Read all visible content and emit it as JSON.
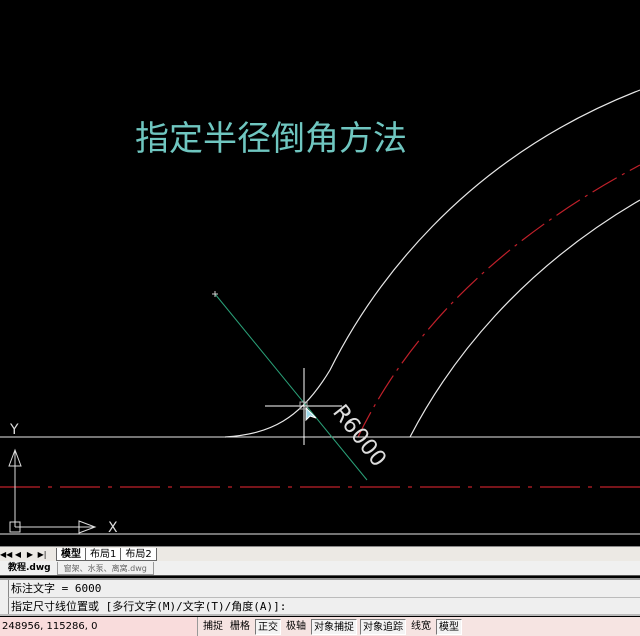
{
  "drawing": {
    "title": "指定半径倒角方法",
    "dim_text": "R6000",
    "ucs_x": "X",
    "ucs_y": "Y"
  },
  "colors": {
    "background": "#000000",
    "line": "#ffffff",
    "centerline": "#c0202a",
    "title": "#6fc6c0",
    "dimension": "#2aa078"
  },
  "layout_tabs": {
    "nav": [
      "◀◀",
      "◀",
      "▶",
      "▶|"
    ],
    "tabs": [
      {
        "label": "模型",
        "active": true
      },
      {
        "label": "布局1"
      },
      {
        "label": "布局2"
      }
    ]
  },
  "file_tabs": [
    {
      "label": "教程.dwg",
      "active": true
    },
    {
      "label": "窗架、水泵、离窝.dwg"
    }
  ],
  "command": {
    "lines": [
      "标注文字 = 6000",
      "指定尺寸线位置或 [多行文字(M)/文字(T)/角度(A)]:"
    ]
  },
  "status": {
    "coords": "248956, 115286, 0",
    "buttons": [
      {
        "label": "捕捉",
        "on": false
      },
      {
        "label": "栅格",
        "on": false
      },
      {
        "label": "正交",
        "on": true
      },
      {
        "label": "极轴",
        "on": false
      },
      {
        "label": "对象捕捉",
        "on": true
      },
      {
        "label": "对象追踪",
        "on": true
      },
      {
        "label": "线宽",
        "on": false
      },
      {
        "label": "模型",
        "on": true
      }
    ]
  }
}
